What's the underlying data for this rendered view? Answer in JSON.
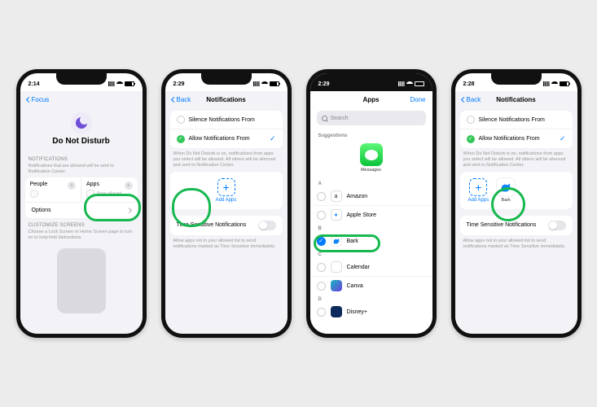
{
  "phone1": {
    "time": "2:14",
    "back": "Focus",
    "hero_title": "Do Not Disturb",
    "notif_label": "NOTIFICATIONS",
    "notif_desc": "Notifications that are allowed will be sent to Notification Center.",
    "people": "People",
    "apps": "Apps",
    "none_allowed": "None allowed",
    "options": "Options",
    "customize_label": "CUSTOMIZE SCREENS",
    "customize_desc": "Choose a Lock Screen or Home Screen page to turn on to help limit distractions."
  },
  "phone2": {
    "time": "2:29",
    "back": "Back",
    "title": "Notifications",
    "silence": "Silence Notifications From",
    "allow": "Allow Notifications From",
    "allow_desc": "When Do Not Disturb is on, notifications from apps you select will be allowed. All others will be silenced and sent to Notification Center.",
    "add_apps": "Add Apps",
    "time_sensitive": "Time Sensitive Notifications",
    "time_desc": "Allow apps not in your allowed list to send notifications marked as Time Sensitive immediately."
  },
  "phone3": {
    "time": "2:29",
    "title": "Apps",
    "done": "Done",
    "search": "Search",
    "suggestions": "Suggestions",
    "messages": "Messages",
    "sections": {
      "A": [
        {
          "name": "Amazon",
          "color": "#fff",
          "border": "#ccc"
        },
        {
          "name": "Apple Store",
          "color": "#fff",
          "border": "#ccc"
        }
      ],
      "B": [
        {
          "name": "Bark",
          "selected": true
        }
      ],
      "C": [
        {
          "name": "Calendar",
          "color": "#fff",
          "border": "#ccc"
        },
        {
          "name": "Canva",
          "color": "#17b6c6"
        }
      ],
      "D": [
        {
          "name": "Disney+",
          "color": "#0b2a5b"
        }
      ]
    }
  },
  "phone4": {
    "time": "2:28",
    "back": "Back",
    "title": "Notifications",
    "silence": "Silence Notifications From",
    "allow": "Allow Notifications From",
    "allow_desc": "When Do Not Disturb is on, notifications from apps you select will be allowed. All others will be silenced and sent to Notification Center.",
    "add_apps": "Add Apps",
    "bark": "Bark",
    "time_sensitive": "Time Sensitive Notifications",
    "time_desc": "Allow apps not in your allowed list to send notifications marked as Time Sensitive immediately."
  }
}
